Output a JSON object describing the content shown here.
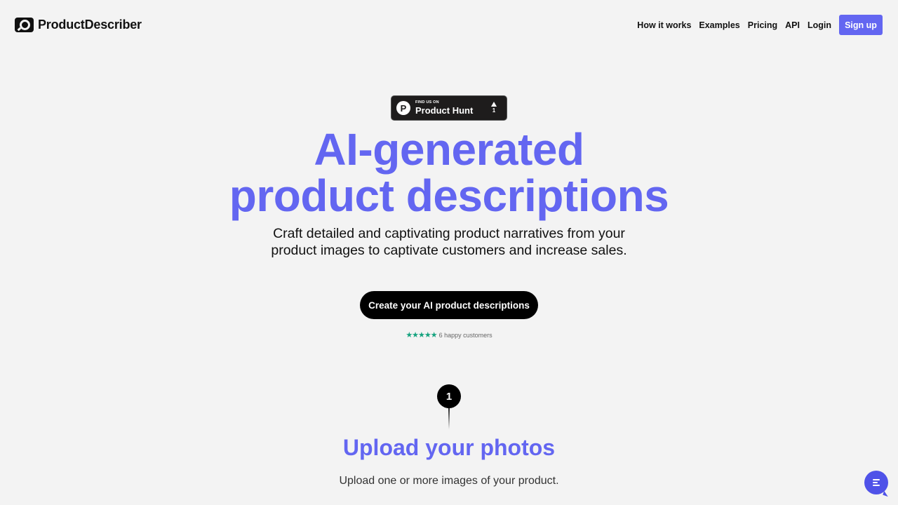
{
  "header": {
    "brand": "ProductDescriber",
    "nav": [
      {
        "label": "How it works"
      },
      {
        "label": "Examples"
      },
      {
        "label": "Pricing"
      },
      {
        "label": "API"
      },
      {
        "label": "Login"
      }
    ],
    "signup_label": "Sign up"
  },
  "badge": {
    "small_text": "FIND US ON",
    "big_text": "Product Hunt",
    "logo_letter": "P",
    "votes": "1"
  },
  "hero": {
    "headline_line1": "AI-generated",
    "headline_line2": "product descriptions",
    "subtitle": "Craft detailed and captivating product narratives from your product images to captivate customers and increase sales.",
    "cta_label": "Create your AI product descriptions",
    "stars": "★★★★★",
    "rating_text": "6 happy customers"
  },
  "step": {
    "number": "1",
    "title": "Upload your photos",
    "description": "Upload one or more images of your product."
  },
  "colors": {
    "accent": "#6366f1",
    "background": "#f3f3f3",
    "star": "#16a37f"
  }
}
